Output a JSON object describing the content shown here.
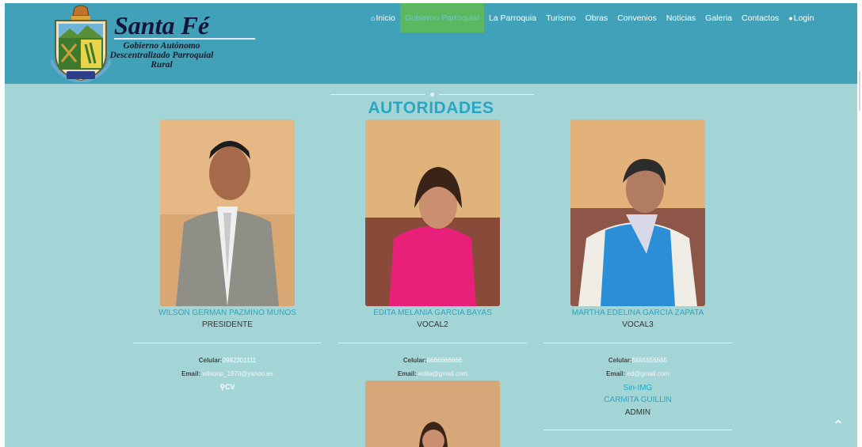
{
  "brand": {
    "title": "Santa Fé",
    "subtitle": "Gobierno Autónomo Descentralizado Parroquial Rural"
  },
  "nav": {
    "items": [
      {
        "label": "Inicio",
        "icon": "home-icon",
        "active": false
      },
      {
        "label": "Gobierno Parroquial",
        "icon": "",
        "active": true
      },
      {
        "label": "La Parroquia",
        "icon": "",
        "active": false
      },
      {
        "label": "Turismo",
        "icon": "",
        "active": false
      },
      {
        "label": "Obras",
        "icon": "",
        "active": false
      },
      {
        "label": "Convenios",
        "icon": "",
        "active": false
      },
      {
        "label": "Noticias",
        "icon": "",
        "active": false
      },
      {
        "label": "Galeria",
        "icon": "",
        "active": false
      },
      {
        "label": "Contactos",
        "icon": "",
        "active": false
      },
      {
        "label": "Login",
        "icon": "user-icon",
        "active": false
      }
    ]
  },
  "section": {
    "title": "AUTORIDADES"
  },
  "authorities": [
    {
      "name": "WILSON GERMAN PAZMINO MUNOS",
      "role": "PRESIDENTE",
      "celular_label": "Celular:",
      "celular": "0992201111",
      "email_label": "Email:",
      "email": "wilsonp_1970@yahoo.es",
      "cv_label": "CV"
    },
    {
      "name": "EDITA MELANIA GARCIA BAYAS",
      "role": "VOCAL2",
      "celular_label": "Celular:",
      "celular": "6666666666",
      "email_label": "Email:",
      "email": "edita@gmail.com"
    },
    {
      "name": "MARTHA EDELINA GARCIA ZAPATA",
      "role": "VOCAL3",
      "celular_label": "Celular:",
      "celular": "5555555555",
      "email_label": "Email:",
      "email": "ed@gmail.com"
    }
  ],
  "extra": {
    "sin_img": "Sin-IMG",
    "name": "CARMITA GUILLIN",
    "role": "ADMIN"
  },
  "colors": {
    "navbar": "#41a1b8",
    "page_bg": "#a4d5d6",
    "active_tab": "#5cb860",
    "accent": "#2aa6c4"
  },
  "icons": {
    "scroll_top": "chevron-up-icon",
    "cv": "search-icon"
  }
}
